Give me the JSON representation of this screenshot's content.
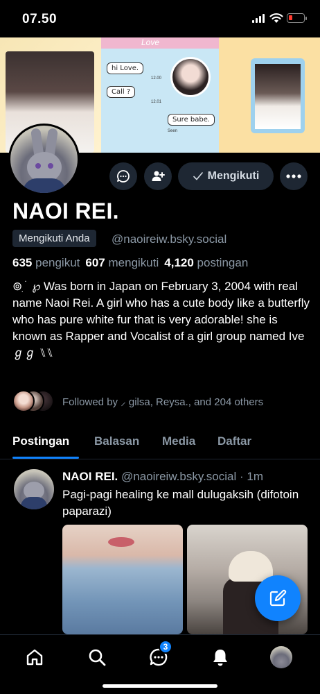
{
  "status_bar": {
    "time": "07.50"
  },
  "banner": {
    "love_label": "Love",
    "bubble_1": "hi Love.",
    "bubble_2": "Call ?",
    "bubble_3": "Sure babe.",
    "time_1": "12.00",
    "time_2": "12.01",
    "seen": "Seen"
  },
  "profile": {
    "name": "NAOI REI.",
    "follows_you_badge": "Mengikuti Anda",
    "handle": "@naoireiw.bsky.social",
    "stats": [
      {
        "count": "635",
        "label": "pengikut"
      },
      {
        "count": "607",
        "label": "mengikuti"
      },
      {
        "count": "4,120",
        "label": "postingan"
      }
    ],
    "bio": "⊚ ִ ֺ ℘ Was born in Japan on February 3, 2004 with real name Naoi Rei. A girl who has a cute body like a butterfly who has pure white fur that is very adorable! she is known as Rapper and Vocalist of a girl group named Ive ℊℊ ⑊⑊",
    "following_button": "Mengikuti",
    "followed_by": "Followed by ⸝ gilsa, Reysa., and 204 others"
  },
  "tabs": [
    {
      "label": "Postingan",
      "active": true
    },
    {
      "label": "Balasan",
      "active": false
    },
    {
      "label": "Media",
      "active": false
    },
    {
      "label": "Daftar",
      "active": false
    }
  ],
  "post": {
    "author": "NAOI REI.",
    "handle_time": "@naoireiw.bsky.social · 1m",
    "text": "Pagi-pagi healing ke mall dulugaksih (difotoin paparazi)"
  },
  "bottom_nav": {
    "chat_badge": "3",
    "items": [
      "home-icon",
      "search-icon",
      "chat-icon",
      "bell-icon",
      "profile-avatar"
    ]
  },
  "colors": {
    "accent": "#1083fe",
    "muted_text": "#8b98a5",
    "button_bg": "#1e2733",
    "background": "#000000"
  }
}
